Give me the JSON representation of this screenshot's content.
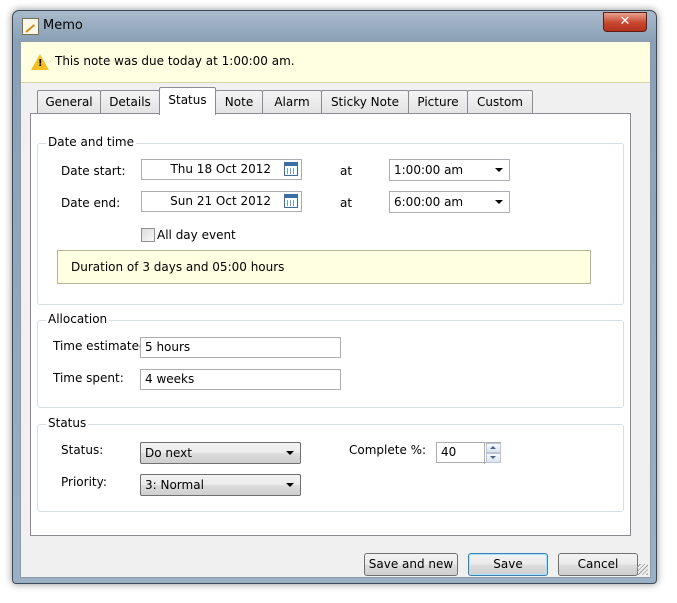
{
  "window": {
    "title": "Memo",
    "close_glyph": "✕"
  },
  "info_bar": {
    "icon": "warning-icon",
    "message": "This note was due today at 1:00:00 am."
  },
  "tabs": [
    {
      "label": "General",
      "active": false
    },
    {
      "label": "Details",
      "active": false
    },
    {
      "label": "Status",
      "active": true
    },
    {
      "label": "Note",
      "active": false
    },
    {
      "label": "Alarm",
      "active": false
    },
    {
      "label": "Sticky Note",
      "active": false
    },
    {
      "label": "Picture",
      "active": false
    },
    {
      "label": "Custom",
      "active": false
    }
  ],
  "date_time": {
    "group_label": "Date and time",
    "start_label": "Date start:",
    "start_date": "Thu 18 Oct 2012",
    "start_at_label": "at",
    "start_time": "1:00:00 am",
    "end_label": "Date end:",
    "end_date": "Sun 21 Oct 2012",
    "end_at_label": "at",
    "end_time": "6:00:00 am",
    "all_day_label": "All day event",
    "all_day_checked": false,
    "duration_text": "Duration of 3 days and 05:00 hours"
  },
  "allocation": {
    "group_label": "Allocation",
    "estimated_label": "Time estimated:",
    "estimated_value": "5 hours",
    "spent_label": "Time spent:",
    "spent_value": "4 weeks"
  },
  "status": {
    "group_label": "Status",
    "status_label": "Status:",
    "status_value": "Do next",
    "priority_label": "Priority:",
    "priority_value": "3: Normal",
    "complete_label": "Complete %:",
    "complete_value": "40"
  },
  "buttons": {
    "save_and_new": "Save and new",
    "save": "Save",
    "cancel": "Cancel"
  }
}
